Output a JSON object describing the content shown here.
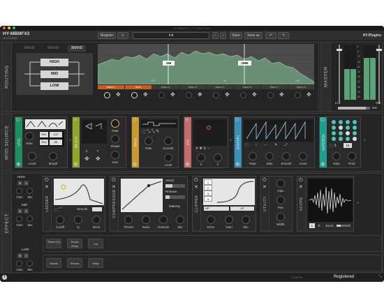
{
  "window": {
    "title": "HY-MBMFX3 - FX Multi Effect"
  },
  "toolbar": {
    "brand": "HY-MBMFX3",
    "version": "v6.9.4 DEMO",
    "register": "Register",
    "menu": "≡",
    "preset": "Init",
    "prev": "‹",
    "next": "›",
    "save": "Save",
    "saveas": "Save as",
    "undo": "↶",
    "redo": "↷",
    "company": "HY-Plugins"
  },
  "routing": {
    "label": "ROUTING",
    "tabs": [
      "1BAND",
      "2BAND",
      "3BAND"
    ],
    "bands": [
      "HIGH",
      "MID",
      "LOW"
    ],
    "freq1": "199",
    "freq2": "1999",
    "axis": [
      "100",
      "1K",
      "10K"
    ],
    "macros": [
      "Macro 1",
      "Drive",
      "Macro 3",
      "Macro 4",
      "Macro 5",
      "Macro 6",
      "Macro 7",
      "Macro 8"
    ]
  },
  "master": {
    "label": "MASTER",
    "in": "In",
    "out": "Out",
    "mix": "Mix",
    "scale": [
      "0",
      "-6",
      "-12",
      "-18",
      "-24",
      "-30",
      "-36",
      "-42",
      "-48",
      "-54",
      "-60"
    ]
  },
  "modsource": {
    "label": "MOD SOURCE",
    "lfo": {
      "name": "LFO1",
      "rate": "Rate",
      "level": "Level",
      "morph": "Morph",
      "v1": "Ph1",
      "n1": "137",
      "v2": "Ph2",
      "n2": "55"
    },
    "xy2": {
      "name": "2DLFO1",
      "rate": "Rate",
      "shape": "Shape",
      "size": "Size",
      "x": "X",
      "y": "Y"
    },
    "rnd": {
      "name": "RND1",
      "rate": "Rate",
      "smooth": "Smooth",
      "level": "Level"
    },
    "xy1": {
      "name": "XY1",
      "x": "X",
      "y": "Y"
    },
    "shaper": {
      "name": "SHAPER1",
      "rate": "Rate",
      "jitter": "Jitter",
      "smooth": "Smooth",
      "level": "Level"
    },
    "gate": {
      "name": "GATESEQ1",
      "rate": "Rate",
      "prob": "Prob",
      "steps": "16"
    }
  },
  "effect": {
    "label": "EFFECT",
    "high": "HIGH",
    "mid": "MID",
    "low": "LOW",
    "m": "M",
    "s": "S",
    "gain": "Gain",
    "mix": "Mix",
    "ladder": {
      "name": "LADDER",
      "smooth": "Smooth",
      "cutoff": "Cutoff",
      "q": "Q",
      "drive": "Drive"
    },
    "comp": {
      "name": "COMPRESSOR",
      "attack": "Attack",
      "release": "Release",
      "makeup": "Makeup",
      "thresh": "Thresh",
      "ratio": "Ratio",
      "outgain": "OutGain",
      "mix": "Mix"
    },
    "clipper": {
      "name": "CLIPPER",
      "hp": "HP",
      "lp": "LP",
      "drive": "Drive",
      "gain": "Gain",
      "mix": "Mix",
      "modes": [
        "1",
        "2",
        "3",
        "4"
      ]
    },
    "utility": {
      "name": "UTILITY",
      "gain": "Gain",
      "pan": "Pan",
      "width": "Width"
    },
    "scope": {
      "name": "SCOPE",
      "l": "L",
      "r": "R",
      "zoom": "Zoom"
    },
    "midchips": [
      "3Band EQ",
      "Simple Delay",
      "LoA"
    ],
    "lowchips": [
      "Vibrato",
      "Reverb",
      "Utility"
    ]
  },
  "status": {
    "license": "License",
    "registered": "Registered"
  }
}
